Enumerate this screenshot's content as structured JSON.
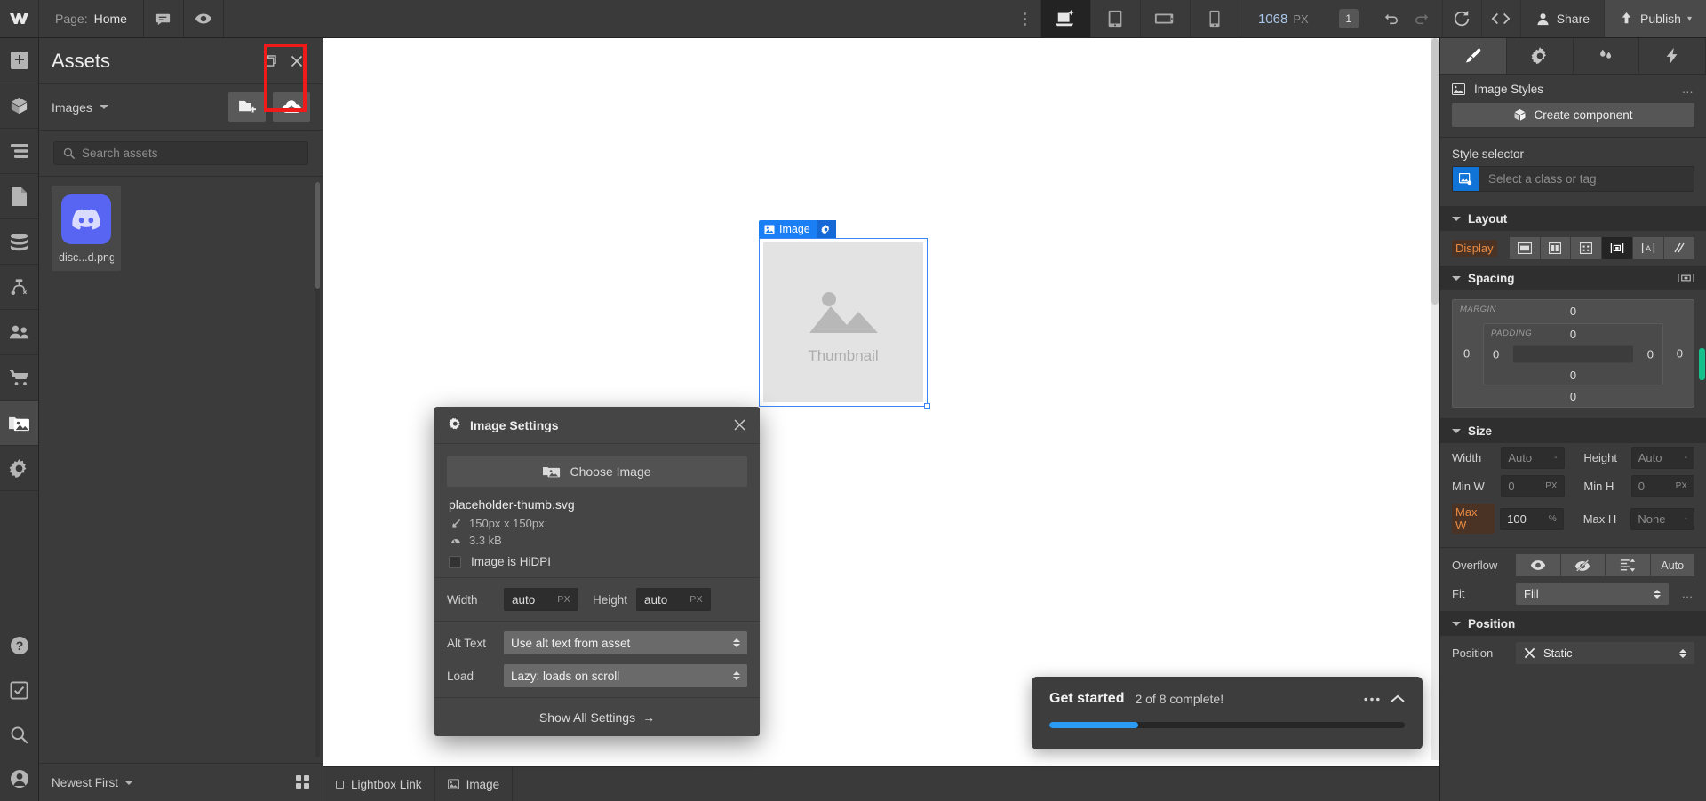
{
  "topbar": {
    "logo": "W",
    "page_label": "Page:",
    "page_name": "Home",
    "comment_icon": "comment-icon",
    "preview_icon": "eye-icon",
    "more_icon": "vertical-dots-icon",
    "breakpoints": [
      {
        "name": "desktop-large",
        "icon": "laptop-star-icon",
        "active": true
      },
      {
        "name": "tablet",
        "icon": "tablet-icon",
        "active": false
      },
      {
        "name": "mobile-landscape",
        "icon": "mobile-landscape-icon",
        "active": false
      },
      {
        "name": "mobile-portrait",
        "icon": "mobile-portrait-icon",
        "active": false
      }
    ],
    "viewport_width": "1068",
    "viewport_unit": "PX",
    "badge_count": "1",
    "undo_icon": "undo-icon",
    "redo_icon": "redo-icon",
    "refresh_icon": "refresh-icon",
    "code_icon": "code-icon",
    "share_label": "Share",
    "publish_label": "Publish"
  },
  "rail": {
    "items": [
      {
        "name": "add-elements",
        "icon": "plus-icon",
        "selected": false
      },
      {
        "name": "components",
        "icon": "cube-icon",
        "selected": false
      },
      {
        "name": "navigator",
        "icon": "layers-list-icon",
        "selected": false
      },
      {
        "name": "pages",
        "icon": "page-icon",
        "selected": false
      },
      {
        "name": "cms",
        "icon": "database-icon",
        "selected": false
      },
      {
        "name": "logic",
        "icon": "logic-flow-icon",
        "selected": false
      },
      {
        "name": "users",
        "icon": "users-icon",
        "selected": false
      },
      {
        "name": "ecommerce",
        "icon": "cart-icon",
        "selected": false
      },
      {
        "name": "assets",
        "icon": "assets-images-icon",
        "selected": true
      },
      {
        "name": "settings",
        "icon": "gear-icon",
        "selected": false
      }
    ],
    "bottom_items": [
      {
        "name": "help",
        "icon": "question-circle-icon"
      },
      {
        "name": "audit",
        "icon": "checkmark-box-icon"
      },
      {
        "name": "search",
        "icon": "magnifier-icon"
      },
      {
        "name": "account",
        "icon": "person-circle-icon"
      }
    ]
  },
  "assets": {
    "title": "Assets",
    "restore_icon": "restore-window-icon",
    "close_icon": "close-icon",
    "filter": "Images",
    "new_folder_icon": "new-folder-icon",
    "upload_icon": "cloud-upload-icon",
    "search_placeholder": "Search assets",
    "search_icon": "search-icon",
    "items": [
      {
        "name": "disc...d.png",
        "thumb": "discord-logo"
      }
    ],
    "sort_label": "Newest First",
    "grid_view_icon": "grid-view-icon"
  },
  "canvas": {
    "element_tag": "Image",
    "element_tag_icon": "image-icon",
    "element_gear_icon": "gear-icon",
    "placeholder_label": "Thumbnail",
    "placeholder_icon": "image-placeholder-icon"
  },
  "image_settings": {
    "title": "Image Settings",
    "title_icon": "gear-icon",
    "close_icon": "close-icon",
    "choose_label": "Choose Image",
    "choose_icon": "image-picker-icon",
    "file_name": "placeholder-thumb.svg",
    "dimensions": "150px x 150px",
    "dimensions_icon": "resize-arrow-icon",
    "file_size": "3.3 kB",
    "file_size_icon": "gauge-icon",
    "hidpi_label": "Image is HiDPI",
    "hidpi_checked": false,
    "width_label": "Width",
    "width_value": "auto",
    "width_unit": "PX",
    "height_label": "Height",
    "height_value": "auto",
    "height_unit": "PX",
    "alt_text_label": "Alt Text",
    "alt_text_value": "Use alt text from asset",
    "load_label": "Load",
    "load_value": "Lazy: loads on scroll",
    "show_all_label": "Show All Settings",
    "show_all_arrow": "arrow-right-icon"
  },
  "toast": {
    "title": "Get started",
    "subtitle": "2 of 8 complete!",
    "more_icon": "ellipsis-icon",
    "collapse_icon": "chevron-up-icon",
    "progress_percent": 25,
    "progress_color": "#2b9bf4"
  },
  "statusbar": {
    "items": [
      {
        "label": "Lightbox Link",
        "icon": "link-icon"
      },
      {
        "label": "Image",
        "icon": "image-icon"
      }
    ]
  },
  "right_panel": {
    "tabs": [
      {
        "name": "style",
        "icon": "paintbrush-icon",
        "active": true
      },
      {
        "name": "settings",
        "icon": "gear-icon",
        "active": false
      },
      {
        "name": "interactions",
        "icon": "droplets-icon",
        "active": false
      },
      {
        "name": "effects",
        "icon": "lightning-icon",
        "active": false
      }
    ],
    "header_title": "Image Styles",
    "header_icon": "image-icon",
    "header_more": "…",
    "create_component_label": "Create component",
    "create_component_icon": "cube-icon",
    "style_selector_label": "Style selector",
    "style_selector_placeholder": "Select a class or tag",
    "style_selector_icon": "element-tag-icon",
    "layout": {
      "title": "Layout",
      "display_label": "Display",
      "display_highlight_color": "#e78a42",
      "options": [
        {
          "name": "display-block",
          "icon": "block-icon",
          "active": false
        },
        {
          "name": "display-flex",
          "icon": "flex-icon",
          "active": false
        },
        {
          "name": "display-grid",
          "icon": "grid-icon",
          "active": false
        },
        {
          "name": "display-inline-block",
          "icon": "inline-block-icon",
          "active": true
        },
        {
          "name": "display-inline",
          "icon": "inline-text-icon",
          "active": false
        },
        {
          "name": "display-none",
          "icon": "none-icon",
          "active": false
        }
      ]
    },
    "spacing": {
      "title": "Spacing",
      "tool_icon": "spacing-mode-icon",
      "margin_label": "MARGIN",
      "padding_label": "PADDING",
      "margin": {
        "top": "0",
        "right": "0",
        "bottom": "0",
        "left": "0"
      },
      "padding": {
        "top": "0",
        "right": "0",
        "bottom": "0",
        "left": "0"
      }
    },
    "size": {
      "title": "Size",
      "width_label": "Width",
      "width_value": "Auto",
      "width_unit": "-",
      "height_label": "Height",
      "height_value": "Auto",
      "height_unit": "-",
      "minw_label": "Min W",
      "minw_value": "0",
      "minw_unit": "PX",
      "minh_label": "Min H",
      "minh_value": "0",
      "minh_unit": "PX",
      "maxw_label": "Max W",
      "maxw_value": "100",
      "maxw_unit": "%",
      "maxh_label": "Max H",
      "maxh_value": "None",
      "maxh_unit": "-",
      "overflow_label": "Overflow",
      "overflow_options": [
        {
          "name": "overflow-visible",
          "icon": "eye-icon",
          "label": ""
        },
        {
          "name": "overflow-hidden",
          "icon": "eye-slash-icon",
          "label": ""
        },
        {
          "name": "overflow-scroll",
          "icon": "scroll-icon",
          "label": ""
        },
        {
          "name": "overflow-auto",
          "icon": "",
          "label": "Auto"
        }
      ],
      "fit_label": "Fit",
      "fit_value": "Fill",
      "fit_more": "…"
    },
    "position": {
      "title": "Position",
      "label": "Position",
      "value": "Static",
      "value_icon": "x-icon"
    }
  }
}
